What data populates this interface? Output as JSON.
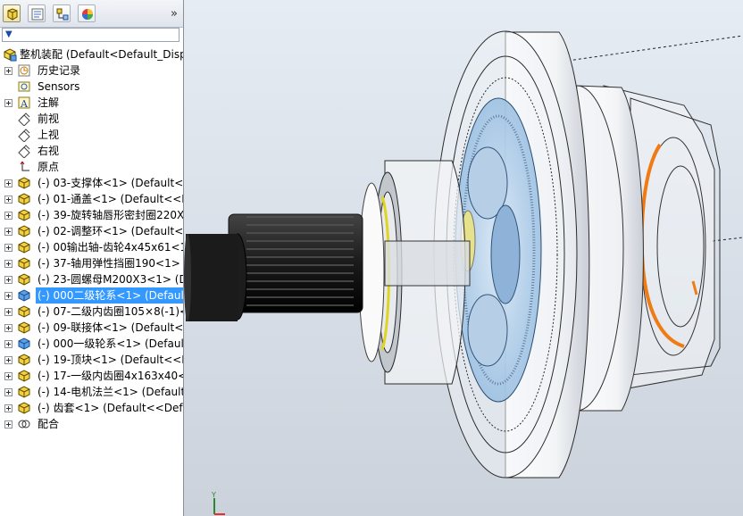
{
  "panel": {
    "tabs": [
      "feature-manager-tab",
      "property-manager-tab",
      "configuration-manager-tab",
      "display-manager-tab"
    ],
    "expand_glyph": "»",
    "filter_glyph": "▼"
  },
  "tree": {
    "root": "整机装配  (Default<Default_Disp",
    "items": [
      {
        "label": "历史记录",
        "icon": "history-icon",
        "expandable": true
      },
      {
        "label": "Sensors",
        "icon": "sensor-icon",
        "expandable": false
      },
      {
        "label": "注解",
        "icon": "annotation-icon",
        "expandable": true
      },
      {
        "label": "前视",
        "icon": "plane-icon",
        "expandable": false
      },
      {
        "label": "上视",
        "icon": "plane-icon",
        "expandable": false
      },
      {
        "label": "右视",
        "icon": "plane-icon",
        "expandable": false
      },
      {
        "label": "原点",
        "icon": "origin-icon",
        "expandable": false
      },
      {
        "label": "(-) 03-支撑体<1> (Default<<",
        "icon": "part-icon",
        "expandable": true
      },
      {
        "label": "(-) 01-通盖<1> (Default<<D",
        "icon": "part-icon",
        "expandable": true
      },
      {
        "label": "(-) 39-旋转轴唇形密封圈220X",
        "icon": "part-icon",
        "expandable": true
      },
      {
        "label": "(-) 02-调整环<1> (Default<<",
        "icon": "part-icon",
        "expandable": true
      },
      {
        "label": "(-) 00输出轴-齿轮4x45x61<1",
        "icon": "part-icon",
        "expandable": true
      },
      {
        "label": "(-) 37-轴用弹性挡圈190<1> (",
        "icon": "part-icon",
        "expandable": true
      },
      {
        "label": "(-) 23-圆螺母M200X3<1> (D",
        "icon": "part-icon",
        "expandable": true
      },
      {
        "label": "(-) 000二级轮系<1> (Default",
        "icon": "subassembly-icon",
        "expandable": true,
        "selected": true
      },
      {
        "label": "(-) 07-二级内齿圈105×8(-1)<",
        "icon": "part-icon",
        "expandable": true
      },
      {
        "label": "(-) 09-联接体<1> (Default<<",
        "icon": "part-icon",
        "expandable": true
      },
      {
        "label": "(-) 000一级轮系<1> (Default",
        "icon": "subassembly-icon",
        "expandable": true
      },
      {
        "label": "(-) 19-顶块<1> (Default<<D",
        "icon": "part-icon",
        "expandable": true
      },
      {
        "label": "(-) 17-一级内齿圈4x163x40<",
        "icon": "part-icon",
        "expandable": true
      },
      {
        "label": "(-) 14-电机法兰<1> (Default",
        "icon": "part-icon",
        "expandable": true
      },
      {
        "label": "(-) 齿套<1> (Default<<Defa",
        "icon": "part-icon",
        "expandable": true
      },
      {
        "label": "配合",
        "icon": "mates-icon",
        "expandable": true
      }
    ]
  },
  "viewport": {
    "model": "planetary-gearbox-assembly",
    "triad_axes": [
      "Y",
      "X"
    ]
  }
}
